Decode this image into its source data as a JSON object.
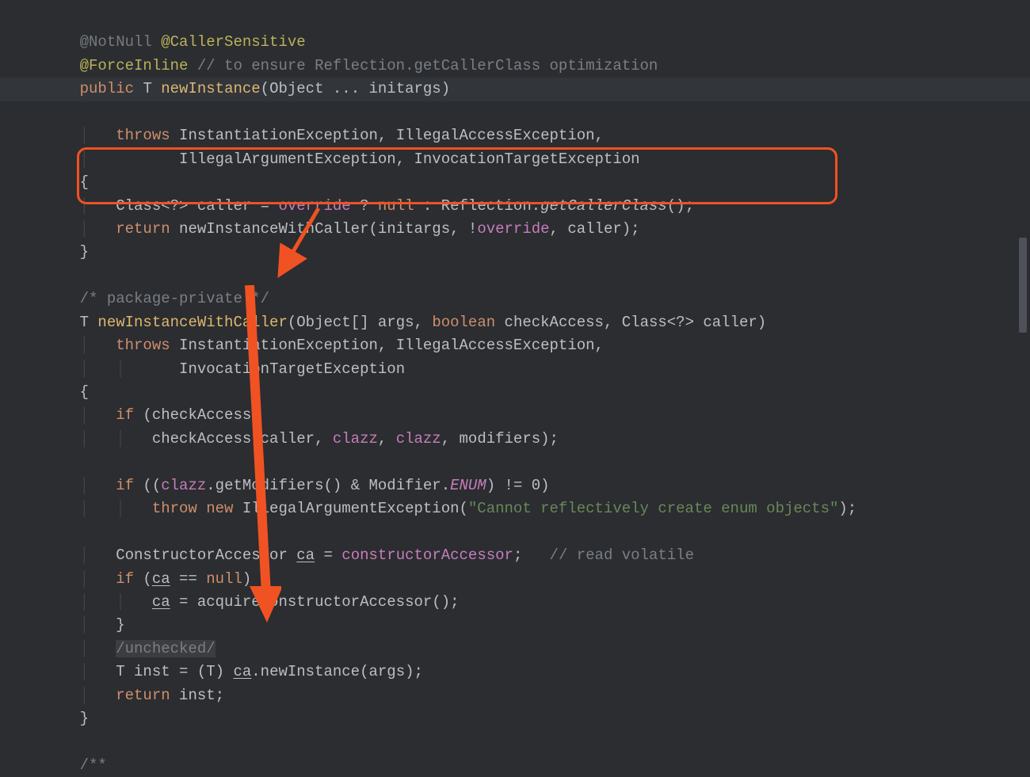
{
  "annotations": {
    "not_null": "@NotNull",
    "caller_sensitive": "@CallerSensitive",
    "force_inline": "@ForceInline",
    "force_inline_comment": "// to ensure Reflection.getCallerClass optimization"
  },
  "m1": {
    "modifier": "public",
    "return_type": "T",
    "name": "newInstance",
    "params_open": "(Object ... initargs)",
    "throws_kw": "throws",
    "ex1": "InstantiationException, IllegalAccessException,",
    "ex2": "IllegalArgumentException, InvocationTargetException",
    "body_l1_a": "Class<?> caller = ",
    "body_l1_override": "override",
    "body_l1_q": " ? ",
    "body_l1_null": "null",
    "body_l1_b": " : Reflection.",
    "body_l1_getcaller": "getCallerClass",
    "body_l1_c": "();",
    "body_l2_return": "return",
    "body_l2_call": " newInstanceWithCaller(initargs, !",
    "body_l2_override": "override",
    "body_l2_tail": ", caller);"
  },
  "pkg_comment": "/* package-private */",
  "m2": {
    "return_type": "T",
    "name": "newInstanceWithCaller",
    "params": "(Object[] args, ",
    "boolean_kw": "boolean",
    "params_tail": " checkAccess, Class<?> caller)",
    "throws_kw": "throws",
    "ex1": "InstantiationException, IllegalAccessException,",
    "ex2": "InvocationTargetException",
    "if1": "if",
    "if1_cond": " (checkAccess)",
    "if1_body": "checkAccess(caller, ",
    "clazz1": "clazz",
    "sep": ", ",
    "clazz2": "clazz",
    "if1_tail": ", modifiers);",
    "if2": "if",
    "if2_open": " ((",
    "if2_clazz": "clazz",
    "if2_dot": ".getModifiers() & Modifier.",
    "enum": "ENUM",
    "if2_tail": ") != 0)",
    "throw_kw": "throw new",
    "iae": " IllegalArgumentException(",
    "str": "\"Cannot reflectively create enum objects\"",
    "throw_tail": ");",
    "ca_decl_a": "ConstructorAccessor ",
    "ca": "ca",
    "ca_decl_b": " = ",
    "ca_field": "constructorAccessor",
    "ca_decl_c": ";   ",
    "ca_comment": "// read volatile",
    "if3": "if",
    "if3_open": " (",
    "if3_ca": "ca",
    "if3_cond": " == ",
    "if3_null": "null",
    "if3_tail": ") {",
    "ca_assign_a": "ca",
    "ca_assign_b": " = acquireConstructorAccessor();",
    "close_brace": "}",
    "unchecked": "/unchecked/",
    "inst_a": "T inst = (T) ",
    "inst_ca": "ca",
    "inst_b": ".newInstance(args);",
    "ret_kw": "return",
    "ret_tail": " inst;"
  },
  "tail_comment": "/**",
  "colors": {
    "accent": "#f05223",
    "bg": "#2b2d30"
  }
}
